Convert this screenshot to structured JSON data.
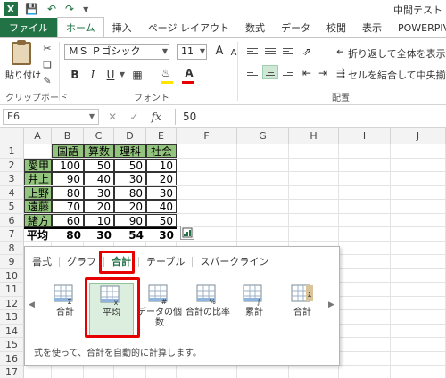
{
  "window": {
    "title": "中間テスト"
  },
  "ribbon_tabs": [
    "ファイル",
    "ホーム",
    "挿入",
    "ページ レイアウト",
    "数式",
    "データ",
    "校閲",
    "表示",
    "POWERPIVOT"
  ],
  "active_tab": "ホーム",
  "home": {
    "paste_label": "貼り付け",
    "clipboard_group": "クリップボード",
    "font_group": "フォント",
    "alignment_group": "配置",
    "font_name": "ＭＳ Ｐゴシック",
    "font_size": "11",
    "grow_font": "A",
    "shrink_font": "A",
    "bold": "B",
    "italic": "I",
    "underline": "U",
    "wrap_text": "折り返して全体を表示する",
    "merge_center": "セルを結合して中央揃え",
    "fill_color": "#ffe600",
    "font_color": "#e60000"
  },
  "formula_bar": {
    "name_box": "E6",
    "cancel": "✕",
    "enter": "✓",
    "fx": "fx",
    "value": "50"
  },
  "sheet": {
    "columns": [
      "A",
      "B",
      "C",
      "D",
      "E",
      "F",
      "G",
      "H",
      "I",
      "J"
    ],
    "rows": [
      "1",
      "2",
      "3",
      "4",
      "5",
      "6",
      "7",
      "8",
      "9",
      "10",
      "11",
      "12",
      "13",
      "14",
      "15",
      "16",
      "17"
    ],
    "header": [
      "国語",
      "算数",
      "理科",
      "社会"
    ],
    "students": [
      {
        "name": "愛甲",
        "scores": [
          "100",
          "50",
          "50",
          "10"
        ]
      },
      {
        "name": "井上",
        "scores": [
          "90",
          "40",
          "30",
          "20"
        ]
      },
      {
        "name": "上野",
        "scores": [
          "80",
          "30",
          "80",
          "30"
        ]
      },
      {
        "name": "遠藤",
        "scores": [
          "70",
          "20",
          "20",
          "40"
        ]
      },
      {
        "name": "緒方",
        "scores": [
          "60",
          "10",
          "90",
          "50"
        ]
      }
    ],
    "average_label": "平均",
    "averages": [
      "80",
      "30",
      "54",
      "30"
    ],
    "colors": {
      "header_fill": "#93c47d"
    }
  },
  "quick_analysis": {
    "tabs": [
      "書式",
      "グラフ",
      "合計",
      "テーブル",
      "スパークライン"
    ],
    "active_tab": "合計",
    "items": [
      "合計",
      "平均",
      "データの個数",
      "合計の比率",
      "累計",
      "合計"
    ],
    "selected_item": "平均",
    "description": "式を使って、合計を自動的に計算します。",
    "highlight_color": "#e60000"
  }
}
